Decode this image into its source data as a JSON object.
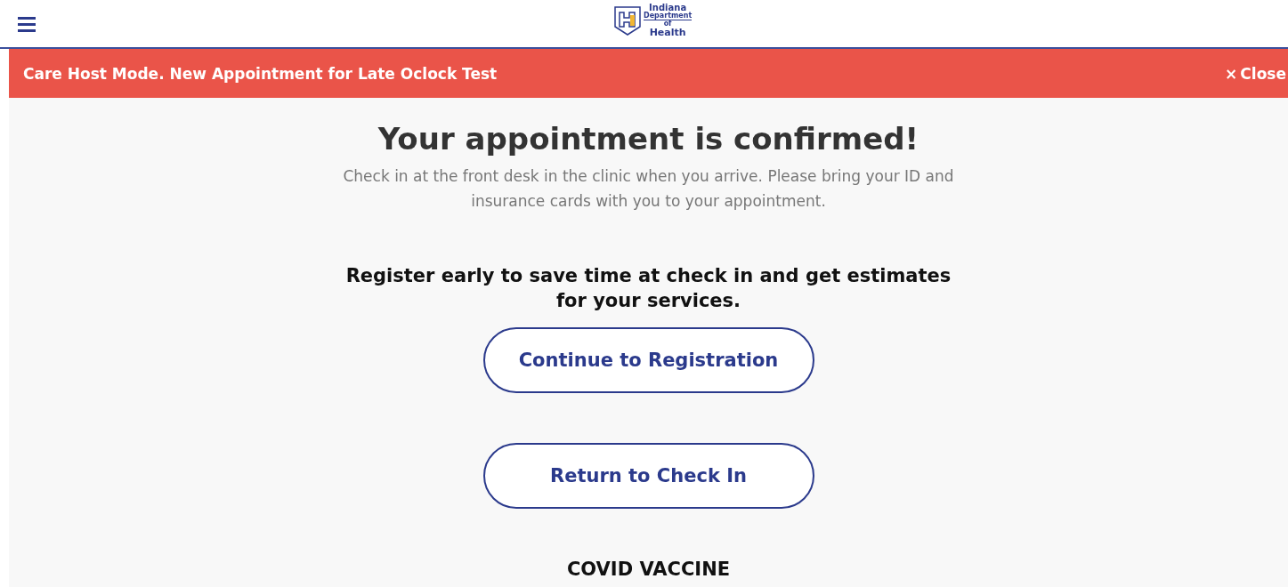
{
  "header": {
    "logo": {
      "lines": [
        "Indiana",
        "Department",
        "of",
        "Health"
      ]
    }
  },
  "banner": {
    "message": "Care Host Mode. New Appointment for Late Oclock Test",
    "close_icon": "×",
    "close_label": "Close"
  },
  "confirmation": {
    "title": "Your appointment is confirmed!",
    "subtitle": "Check in at the front desk in the clinic when you arrive. Please bring your ID and insurance cards with you to your appointment.",
    "register_prompt": "Register early to save time at check in and get estimates for your services."
  },
  "buttons": [
    {
      "label": "Continue to Registration"
    },
    {
      "label": "Return to Check In"
    }
  ],
  "service_heading": "COVID VACCINE"
}
